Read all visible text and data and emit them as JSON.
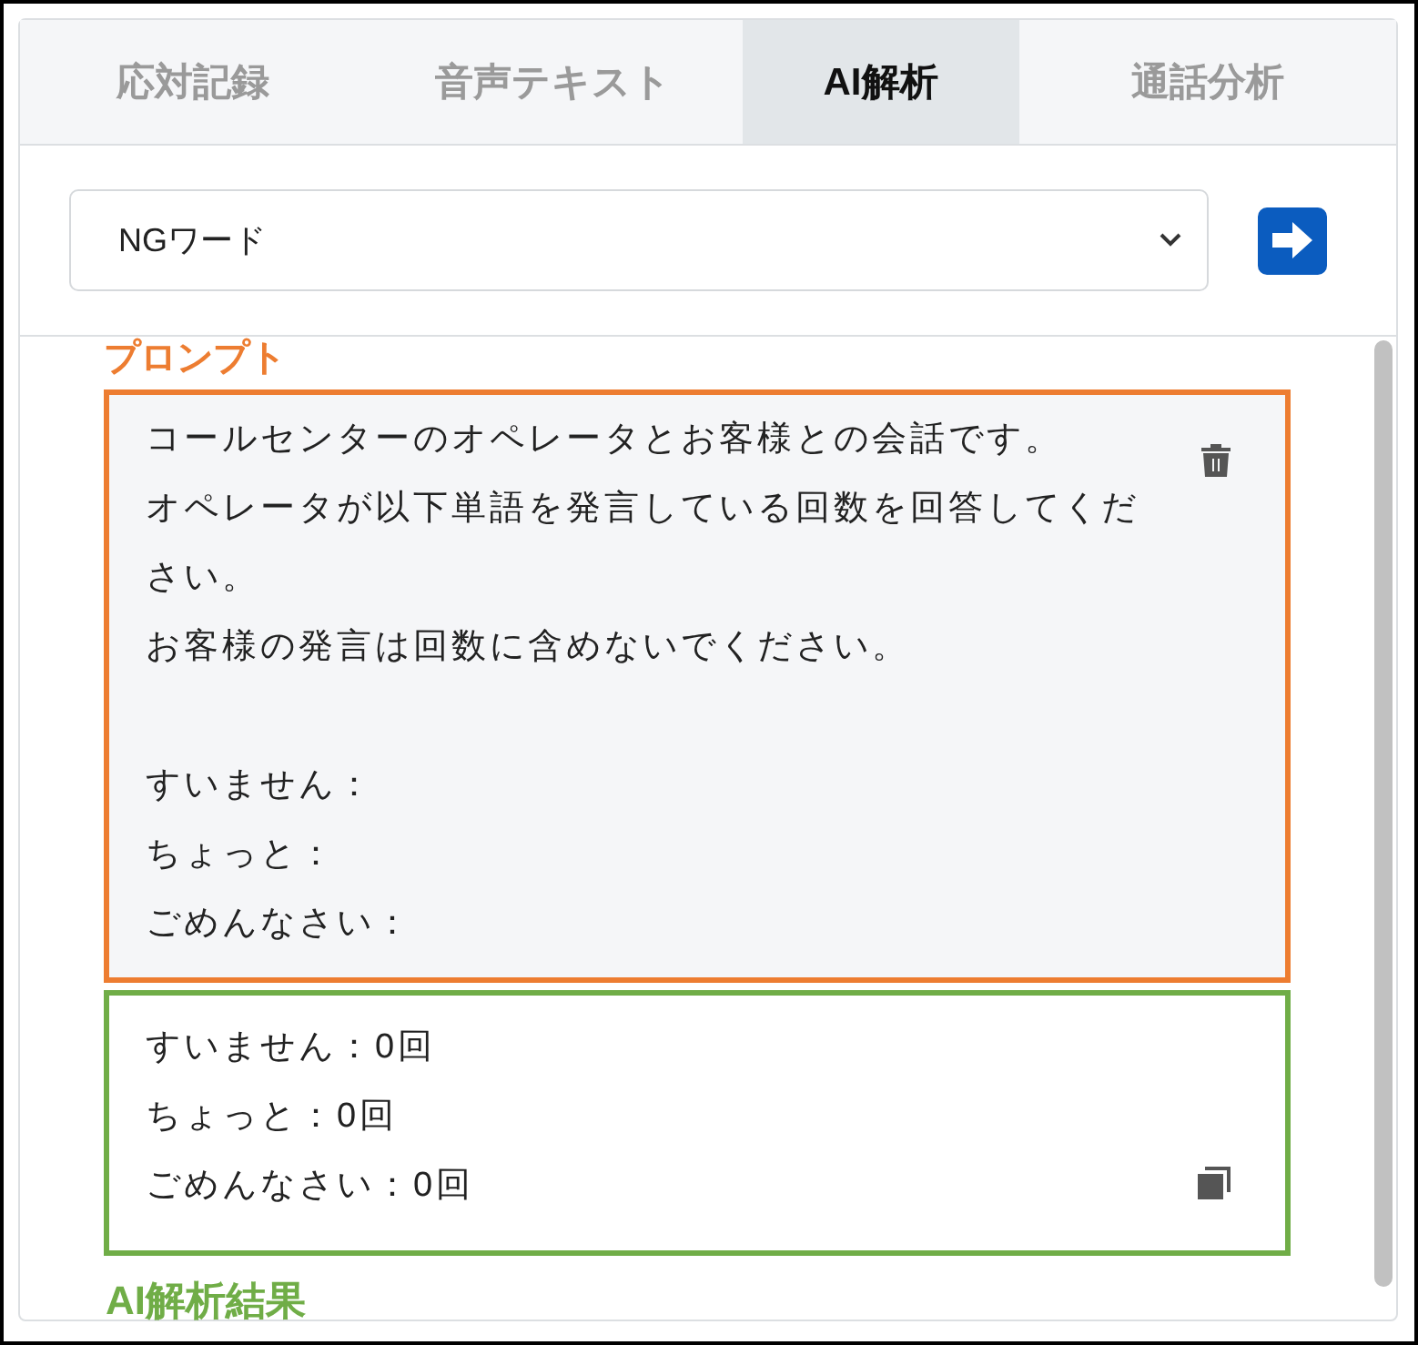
{
  "tabs": [
    {
      "label": "応対記録",
      "selected": false
    },
    {
      "label": "音声テキスト",
      "selected": false
    },
    {
      "label": "AI解析",
      "selected": true
    },
    {
      "label": "通話分析",
      "selected": false
    }
  ],
  "prompt_select": {
    "value": "NGワード"
  },
  "prompt_label": "プロンプト",
  "prompt_paragraphs": [
    [
      "コールセンターのオペレータとお客様との会話です。",
      "オペレータが以下単語を発言している回数を回答してください。",
      "お客様の発言は回数に含めないでください。"
    ],
    [
      "すいません：",
      "ちょっと：",
      "ごめんなさい："
    ]
  ],
  "result_lines": [
    "すいません：0回",
    "ちょっと：0回",
    "ごめんなさい：0回"
  ],
  "result_label": "AI解析結果"
}
